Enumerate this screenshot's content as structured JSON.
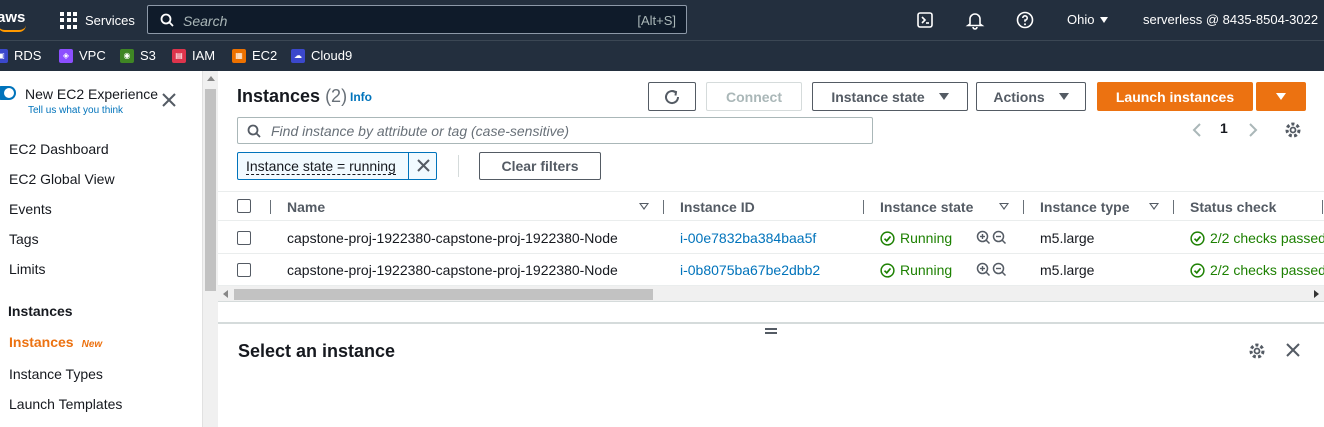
{
  "topnav": {
    "logo": "aws",
    "services_label": "Services",
    "search_placeholder": "Search",
    "search_shortcut": "[Alt+S]",
    "region": "Ohio",
    "account": "serverless @ 8435-8504-3022"
  },
  "favorites": [
    {
      "label": "RDS",
      "color": "#3b48cc"
    },
    {
      "label": "VPC",
      "color": "#8c4fff"
    },
    {
      "label": "S3",
      "color": "#3f8624"
    },
    {
      "label": "IAM",
      "color": "#dd344c"
    },
    {
      "label": "EC2",
      "color": "#ed7100"
    },
    {
      "label": "Cloud9",
      "color": "#3b48cc"
    }
  ],
  "sidebar": {
    "new_experience": "New EC2 Experience",
    "tell_us": "Tell us what you think",
    "links": [
      "EC2 Dashboard",
      "EC2 Global View",
      "Events",
      "Tags",
      "Limits"
    ],
    "section": "Instances",
    "active": "Instances",
    "active_badge": "New",
    "sub_links": [
      "Instance Types",
      "Launch Templates"
    ]
  },
  "main": {
    "title": "Instances",
    "count": "(2)",
    "info": "Info",
    "buttons": {
      "connect": "Connect",
      "instance_state": "Instance state",
      "actions": "Actions",
      "launch": "Launch instances"
    },
    "filter_placeholder": "Find instance by attribute or tag (case-sensitive)",
    "page": "1",
    "chip": "Instance state = running",
    "clear_filters": "Clear filters",
    "columns": [
      "Name",
      "Instance ID",
      "Instance state",
      "Instance type",
      "Status check"
    ],
    "rows": [
      {
        "name": "capstone-proj-1922380-capstone-proj-1922380-Node",
        "id": "i-00e7832ba384baa5f",
        "state": "Running",
        "type": "m5.large",
        "status": "2/2 checks passed"
      },
      {
        "name": "capstone-proj-1922380-capstone-proj-1922380-Node",
        "id": "i-0b8075ba67be2dbb2",
        "state": "Running",
        "type": "m5.large",
        "status": "2/2 checks passed"
      }
    ],
    "detail_title": "Select an instance"
  },
  "colors": {
    "accent": "#ec7211",
    "link": "#0073bb",
    "success": "#1d8102",
    "nav_bg": "#232f3e"
  }
}
